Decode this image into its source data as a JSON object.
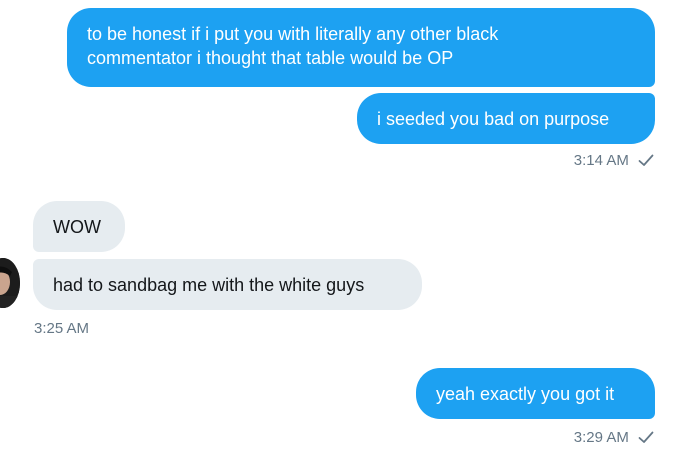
{
  "messages": {
    "m1": "to be honest if i put you with literally any other black commentator i thought that table would be OP",
    "m1_line1": "to be honest if i put you with literally any other black",
    "m1_line2": "commentator i thought that table would be OP",
    "m2": "i seeded you bad on purpose",
    "m3": "WOW",
    "m4": "had to sandbag me with the white guys",
    "m5": "yeah exactly you got it"
  },
  "timestamps": {
    "t1": "3:14 AM",
    "t2": "3:25 AM",
    "t3": "3:29 AM"
  },
  "icons": {
    "read_receipt": "check-icon",
    "avatar": "avatar"
  },
  "colors": {
    "sent_bubble": "#1da1f2",
    "received_bubble": "#e6ecf0",
    "timestamp": "#657786"
  }
}
